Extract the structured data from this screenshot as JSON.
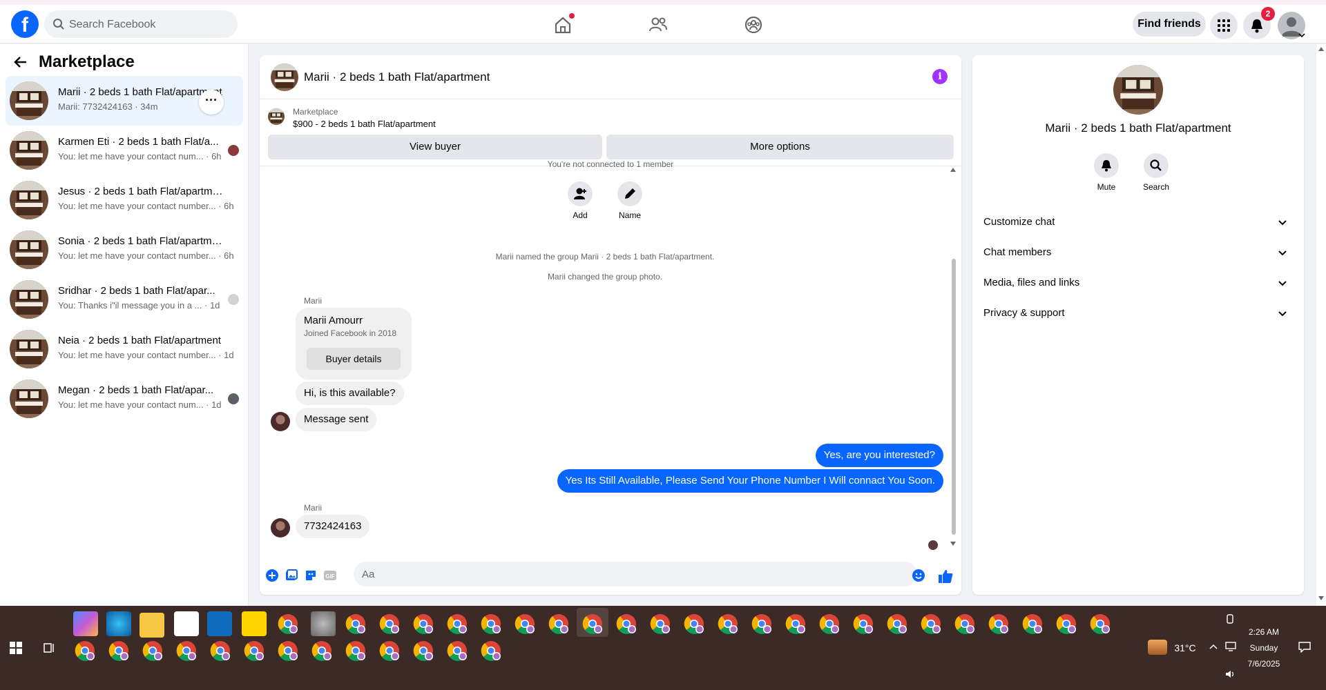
{
  "navbar": {
    "search_placeholder": "Search Facebook",
    "find_friends": "Find friends",
    "notification_count": "2"
  },
  "sidebar": {
    "title": "Marketplace",
    "conversations": [
      {
        "name": "Marii · 2 beds 1 bath Flat/apartment",
        "snippet": "Marii: 7732424163 · 34m",
        "active": true
      },
      {
        "name": "Karmen Eti · 2 beds 1 bath Flat/a...",
        "snippet": "You: let me have your contact num... · 6h"
      },
      {
        "name": "Jesus · 2 beds 1 bath Flat/apartment",
        "snippet": "You: let me have your contact number... · 6h"
      },
      {
        "name": "Sonia · 2 beds 1 bath Flat/apartment",
        "snippet": "You: let me have your contact number... · 6h"
      },
      {
        "name": "Sridhar · 2 beds 1 bath Flat/apar...",
        "snippet": "You: Thanks i\"il message you in a ... · 1d"
      },
      {
        "name": "Neia · 2 beds 1 bath Flat/apartment",
        "snippet": "You: let me have your contact number... · 1d"
      },
      {
        "name": "Megan · 2 beds 1 bath Flat/apar...",
        "snippet": "You: let me have your contact num... · 1d"
      }
    ]
  },
  "chat": {
    "title": "Marii · 2 beds 1 bath Flat/apartment",
    "marketplace_label": "Marketplace",
    "listing": "$900 - 2 beds 1 bath Flat/apartment",
    "view_buyer": "View buyer",
    "more_options": "More options",
    "cut_text": "You're not connected to 1 member",
    "actions": {
      "add": "Add",
      "name": "Name"
    },
    "system_messages": [
      "Marii named the group Marii · 2 beds 1 bath Flat/apartment.",
      "Marii changed the group photo."
    ],
    "sender_name": "Marii",
    "card": {
      "name": "Marii Amourr",
      "sub": "Joined Facebook in 2018",
      "button": "Buyer details"
    },
    "in_msg_1": "Hi, is this available?",
    "in_msg_2": "Message sent",
    "out_msg_1": "Yes, are you interested?",
    "out_msg_2": "Yes Its Still Available, Please Send Your Phone Number I Will connact You Soon.",
    "sender_name_2": "Marii",
    "in_msg_3": "7732424163",
    "composer_placeholder": "Aa"
  },
  "rpanel": {
    "title": "Marii · 2 beds 1 bath Flat/apartment",
    "mute": "Mute",
    "search": "Search",
    "rows": [
      "Customize chat",
      "Chat members",
      "Media, files and links",
      "Privacy & support"
    ]
  },
  "taskbar": {
    "weather": "31°C",
    "time": "2:26 AM",
    "day": "Sunday",
    "date": "7/6/2025"
  },
  "colors": {
    "accent": "#0866ff",
    "badge": "#e41e3f",
    "info": "#a033ff",
    "taskbar": "#3b2a25"
  }
}
